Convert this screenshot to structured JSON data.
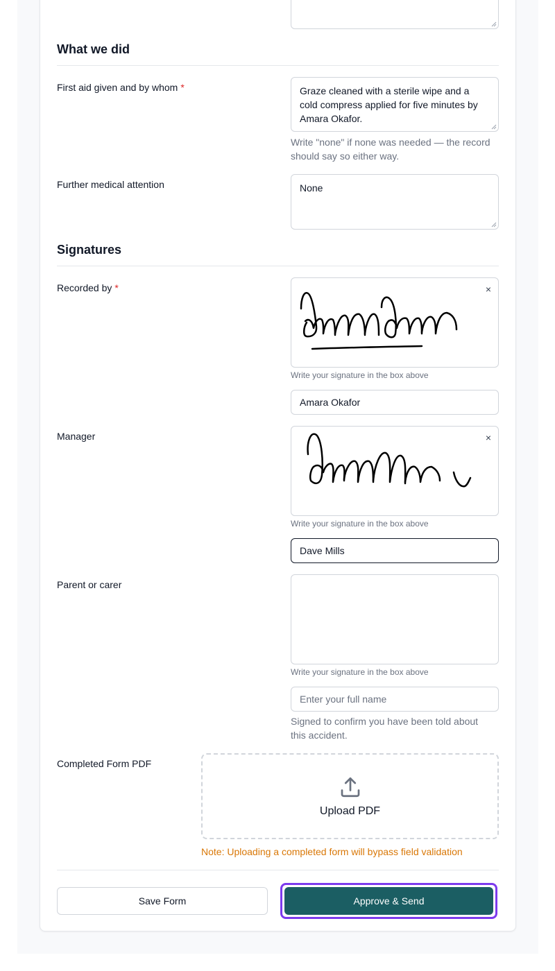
{
  "top_textarea": {
    "value": ""
  },
  "what_we_did": {
    "title": "What we did",
    "first_aid": {
      "label": "First aid given and by whom",
      "required_mark": "*",
      "value_lines": [
        "Graze cleaned with a sterile wipe and a",
        "cold compress applied for five minutes by",
        "Amara Okafor."
      ],
      "help_lines": [
        "Write \"none\" if none was needed — the record",
        "should say so either way."
      ]
    },
    "further_medical": {
      "label": "Further medical attention",
      "value": "None"
    }
  },
  "signatures": {
    "title": "Signatures",
    "recorded_by": {
      "label": "Recorded by",
      "required_mark": "*",
      "clear_label": "×",
      "help": "Write your signature in the box above",
      "name_value": "Amara Okafor"
    },
    "manager": {
      "label": "Manager",
      "clear_label": "×",
      "help": "Write your signature in the box above",
      "name_value": "Dave Mills"
    },
    "parent": {
      "label": "Parent or carer",
      "help": "Write your signature in the box above",
      "name_placeholder": "Enter your full name",
      "confirm_lines": [
        "Signed to confirm you have been told about",
        "this accident."
      ]
    }
  },
  "completed_pdf": {
    "label": "Completed Form PDF",
    "upload_icon": "upload-icon",
    "upload_label": "Upload PDF",
    "note": "Note: Uploading a completed form will bypass field validation"
  },
  "actions": {
    "save_label": "Save Form",
    "approve_label": "Approve & Send"
  },
  "colors": {
    "primary": "#1b5e63",
    "focus_ring": "#7c3aed",
    "required": "#dc2626",
    "note": "#d97706"
  }
}
